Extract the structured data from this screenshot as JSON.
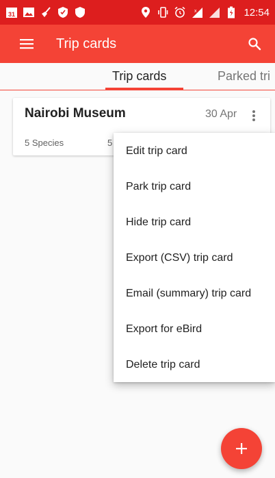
{
  "status_bar": {
    "time": "12:54",
    "calendar_badge": "31",
    "left_icons": [
      "calendar-icon",
      "image-icon",
      "broom-icon",
      "shield-icon",
      "shield-filled-icon"
    ],
    "right_icons": [
      "location-icon",
      "vibrate-icon",
      "alarm-icon",
      "signal-icon",
      "signal-2-icon",
      "battery-icon"
    ]
  },
  "app_bar": {
    "title": "Trip cards",
    "menu_icon": "hamburger-menu-icon",
    "search_icon": "search-icon"
  },
  "tabs": [
    {
      "label": "Trip cards",
      "active": true
    },
    {
      "label": "Parked tri",
      "active": false
    }
  ],
  "card": {
    "title": "Nairobi Museum",
    "date": "30 Apr",
    "species": "5 Species",
    "second_stat": "5"
  },
  "menu": {
    "items": [
      "Edit trip card",
      "Park trip card",
      "Hide trip card",
      "Export (CSV) trip card",
      "Email (summary) trip card",
      "Export for eBird",
      "Delete trip card"
    ]
  },
  "fab": {
    "label": "+"
  },
  "colors": {
    "status_bar": "#dd1e1e",
    "primary": "#f44336",
    "accent_text_white": "#ffffff",
    "tab_active": "#212121",
    "tab_inactive": "#757575"
  }
}
